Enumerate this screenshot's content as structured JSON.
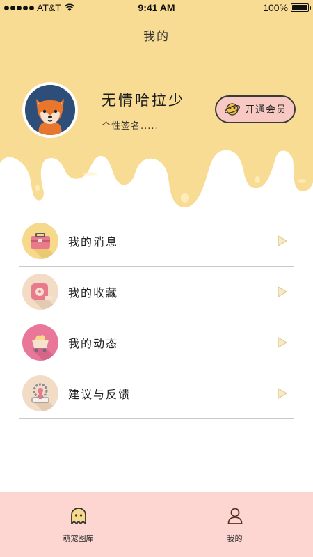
{
  "status_bar": {
    "carrier": "AT&T",
    "time": "9:41 AM",
    "battery": "100%",
    "battery_level": 1.0
  },
  "header": {
    "title": "我的"
  },
  "profile": {
    "username": "无情哈拉少",
    "signature": "个性签名.....",
    "avatar_icon": "shiba-dog-avatar"
  },
  "vip": {
    "label": "开通会员",
    "icon": "planet-icon"
  },
  "menu": {
    "items": [
      {
        "label": "我的消息",
        "icon": "toolbox-icon",
        "icon_bg": "#f6d98a"
      },
      {
        "label": "我的收藏",
        "icon": "tape-measure-icon",
        "icon_bg": "#f2dcc5"
      },
      {
        "label": "我的动态",
        "icon": "mine-cart-icon",
        "icon_bg": "#e9779a"
      },
      {
        "label": "建议与反馈",
        "icon": "gear-device-icon",
        "icon_bg": "#f2dcc5"
      }
    ]
  },
  "tabs": [
    {
      "label": "萌宠图库",
      "icon": "ghost-icon"
    },
    {
      "label": "我的",
      "icon": "user-icon"
    }
  ],
  "colors": {
    "header_yellow": "#f9dc94",
    "tab_bar_pink": "#fdd6d2",
    "vip_pink": "#f8c9c3",
    "avatar_blue": "#2e4e7a"
  }
}
